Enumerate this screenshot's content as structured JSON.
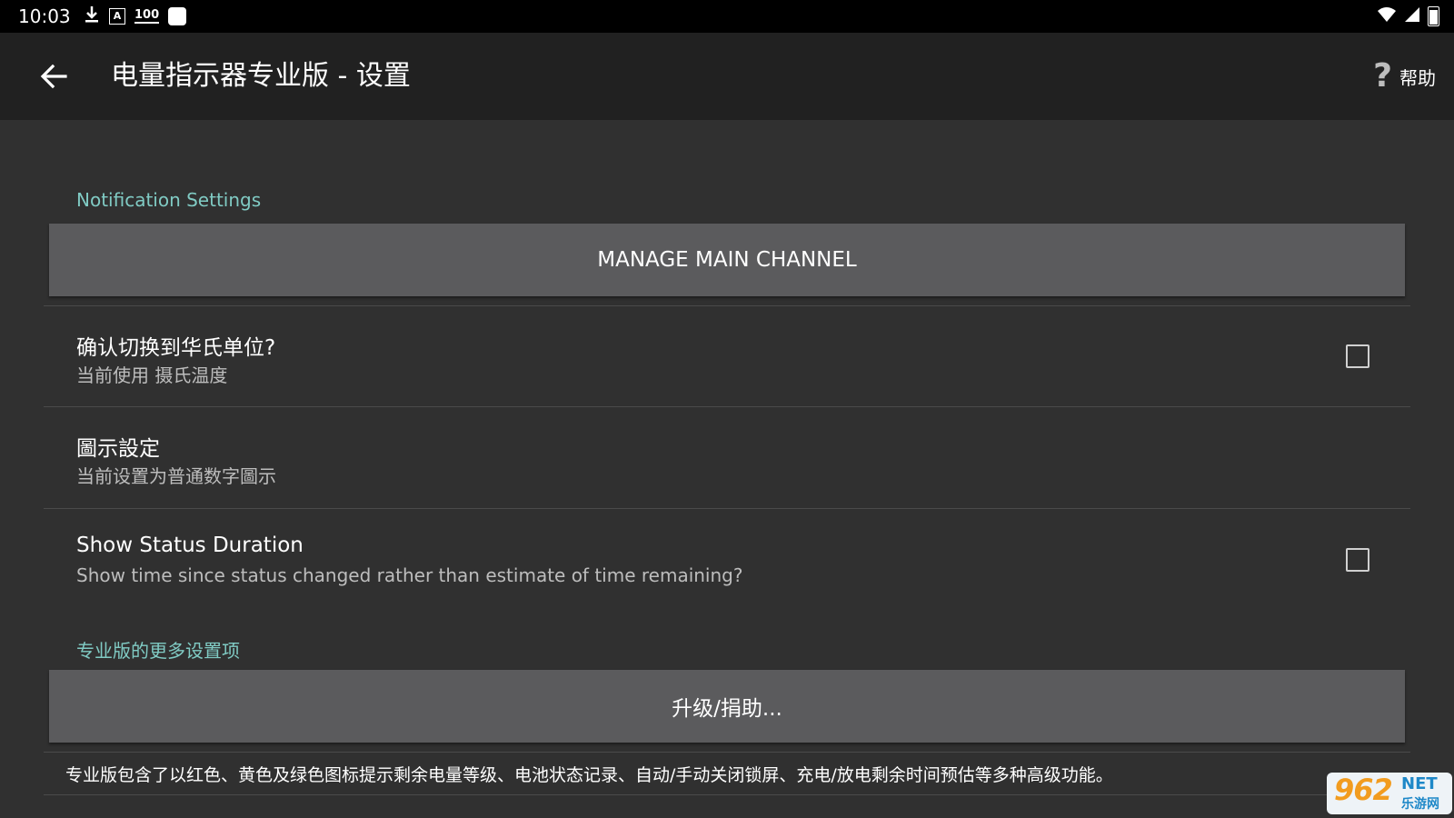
{
  "status_bar": {
    "time": "10:03",
    "icons_left": [
      "download-icon",
      "a-icon",
      "100-icon",
      "square-icon"
    ],
    "icon_100_text": "100",
    "icon_a_text": "A",
    "icons_right": [
      "wifi-icon",
      "signal-icon",
      "battery-icon"
    ]
  },
  "toolbar": {
    "back_icon": "arrow-left-icon",
    "title": "电量指示器专业版 - 设置",
    "help_icon": "question-mark-icon",
    "help_label": "帮助"
  },
  "sections": {
    "notification_header": "Notification Settings",
    "manage_channel_label": "MANAGE MAIN CHANNEL",
    "pro_header": "专业版的更多设置项",
    "upgrade_label": "升级/捐助..."
  },
  "prefs": [
    {
      "title": "确认切换到华氏单位?",
      "summary": "当前使用 摄氏温度",
      "checked": false
    },
    {
      "title": "圖示設定",
      "summary": "当前设置为普通数字圖示"
    },
    {
      "title": "Show Status Duration",
      "summary": "Show time since status changed rather than estimate of time remaining?",
      "checked": false
    }
  ],
  "footer_text": "专业版包含了以红色、黄色及绿色图标提示剩余电量等级、电池状态记录、自动/手动关闭锁屏、充电/放电剩余时间预估等多种高级功能。",
  "watermark": {
    "number": "962",
    "net": "NET",
    "cn": "乐游网"
  },
  "colors": {
    "background": "#303030",
    "toolbar": "#212121",
    "accent": "#80cbc4",
    "button": "#5b5b5d"
  }
}
